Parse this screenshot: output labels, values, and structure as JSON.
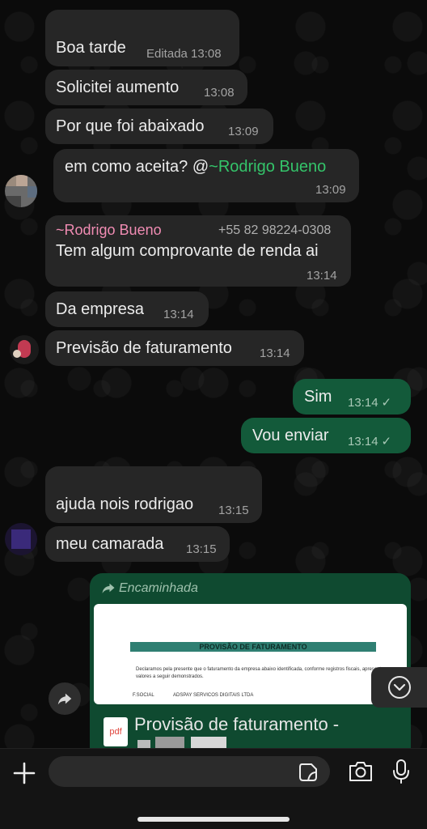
{
  "messages": [
    {
      "text": "Boa tarde",
      "time": "Editada 13:08"
    },
    {
      "text": "Solicitei aumento",
      "time": "13:08"
    },
    {
      "text": "Por que foi abaixado",
      "time": "13:09"
    },
    {
      "text_prefix": "em como aceita? @",
      "mention": "~Rodrigo Bueno",
      "time": "13:09"
    },
    {
      "author": "~Rodrigo Bueno",
      "phone": "+55 82 98224-0308",
      "text": "Tem algum comprovante de renda ai",
      "time": "13:14"
    },
    {
      "text": "Da empresa",
      "time": "13:14"
    },
    {
      "text": "Previsão de faturamento",
      "time": "13:14"
    },
    {
      "text": "Sim",
      "time": "13:14"
    },
    {
      "text": "Vou enviar",
      "time": "13:14"
    },
    {
      "text": "ajuda nois rodrigao",
      "time": "13:15"
    },
    {
      "text": "meu camarada",
      "time": "13:15"
    }
  ],
  "forwarded": {
    "label": "Encaminhada",
    "doc_title": "PROVISÃO DE FATURAMENTO",
    "doc_line1": "Declaramos pela presente que o faturamento da empresa abaixo identificada, conforme registros fiscais, apresenta os",
    "doc_line2": "valores a seguir demonstrados.",
    "doc_field_label": "F.SOCIAL",
    "doc_field_value": "ADSPAY SERVICOS DIGITAIS LTDA",
    "file_icon": "pdf",
    "file_name": "Provisão de faturamento -"
  },
  "colors": {
    "incoming": "#262626",
    "outgoing": "#135a3a",
    "mention": "#34c46a",
    "author": "#f08cb3"
  },
  "icons": [
    "forward-icon",
    "share-icon",
    "scroll-down-icon",
    "plus-icon",
    "sticker-icon",
    "camera-icon",
    "mic-icon"
  ]
}
